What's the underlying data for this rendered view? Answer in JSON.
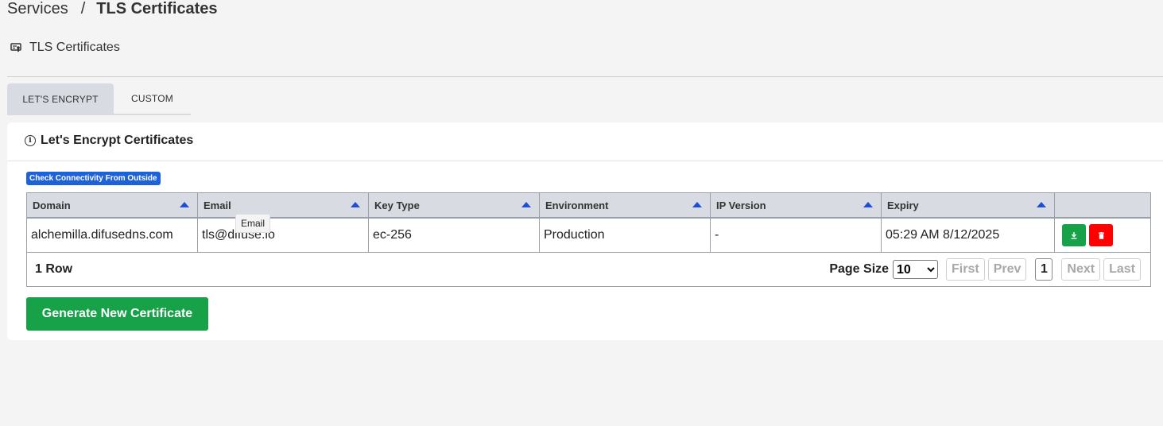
{
  "breadcrumb": {
    "parent": "Services",
    "separator": "/",
    "current": "TLS Certificates"
  },
  "page_header": {
    "title": "TLS Certificates",
    "icon": "certificate-icon"
  },
  "tabs": [
    {
      "label": "LET'S ENCRYPT",
      "active": true
    },
    {
      "label": "CUSTOM",
      "active": false
    }
  ],
  "card": {
    "title": "Let's Encrypt Certificates",
    "check_button_label": "Check Connectivity From Outside"
  },
  "table": {
    "columns": [
      "Domain",
      "Email",
      "Key Type",
      "Environment",
      "IP Version",
      "Expiry",
      ""
    ],
    "rows": [
      {
        "domain": "alchemilla.difusedns.com",
        "email": "tls@difuse.io",
        "key_type": "ec-256",
        "environment": "Production",
        "ip_version": "-",
        "expiry": "05:29 AM 8/12/2025"
      }
    ]
  },
  "footer": {
    "row_count": "1 Row",
    "page_size_label": "Page Size",
    "page_size_value": "10",
    "page_size_options": [
      "10"
    ],
    "first_label": "First",
    "prev_label": "Prev",
    "current_page": "1",
    "next_label": "Next",
    "last_label": "Last"
  },
  "generate_button_label": "Generate New Certificate",
  "tooltip": "Email",
  "colors": {
    "primary_green": "#17a148",
    "danger_red": "#ff0000",
    "badge_blue": "#1d62d8",
    "header_gray": "#d8dbe2"
  }
}
